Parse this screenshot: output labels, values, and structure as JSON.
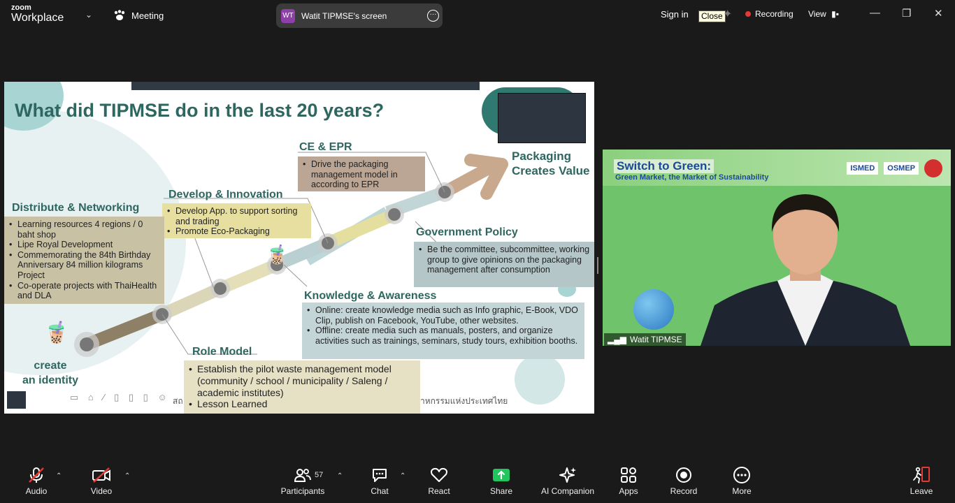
{
  "topbar": {
    "logo_line1": "zoom",
    "logo_line2": "Workplace",
    "meeting_label": "Meeting",
    "share_badge": "WT",
    "share_label": "Watit TIPMSE's screen",
    "sign_in": "Sign in",
    "close_tooltip": "Close",
    "recording": "Recording",
    "view": "View"
  },
  "slide": {
    "title": "What did TIPMSE do in the last 20 years?",
    "packaging": [
      "Packaging",
      "Creates Value"
    ],
    "ce_epr": {
      "heading": "CE & EPR",
      "items": [
        "Drive the packaging management model in according to EPR"
      ]
    },
    "develop": {
      "heading": "Develop & Innovation",
      "items": [
        "Develop App. to support sorting and trading",
        "Promote Eco-Packaging"
      ]
    },
    "distribute": {
      "heading": "Distribute & Networking",
      "items": [
        "Learning resources 4 regions / 0 baht shop",
        "Lipe Royal Development",
        "Commemorating the 84th Birthday Anniversary 84 million kilograms Project",
        "Co-operate projects with ThaiHealth and DLA"
      ]
    },
    "government": {
      "heading": "Government Policy",
      "items": [
        "Be the committee, subcommittee, working group to give opinions on the packaging management after consumption"
      ]
    },
    "knowledge": {
      "heading": "Knowledge & Awareness",
      "items": [
        "Online: create knowledge media such as Info graphic, E-Book, VDO Clip, publish on Facebook, YouTube, other websites.",
        "Offline: create media such as manuals, posters, and organize activities such as trainings, seminars, study tours, exhibition booths."
      ]
    },
    "role_model": {
      "heading": "Role Model",
      "items": [
        "Establish the pilot waste management model (community / school / municipality / Saleng / academic institutes)",
        "Lesson Learned"
      ]
    },
    "create_identity": [
      "create",
      "an identity"
    ],
    "footer_left": "สถ",
    "footer_right": "าหกรรมแห่งประเทศไทย"
  },
  "video": {
    "title": "Switch to Green:",
    "subtitle": "Green Market, the Market of Sustainability",
    "logo1": "ISMED",
    "logo2": "OSMEP",
    "participant_name": "Watit TIPMSE"
  },
  "toolbar": {
    "audio": "Audio",
    "video": "Video",
    "participants": "Participants",
    "participants_count": "57",
    "chat": "Chat",
    "react": "React",
    "share": "Share",
    "ai_companion": "AI Companion",
    "apps": "Apps",
    "record": "Record",
    "more": "More",
    "leave": "Leave"
  },
  "colors": {
    "slide_heading": "#2e6660",
    "share_green": "#22c55e",
    "recording_red": "#e53935"
  }
}
